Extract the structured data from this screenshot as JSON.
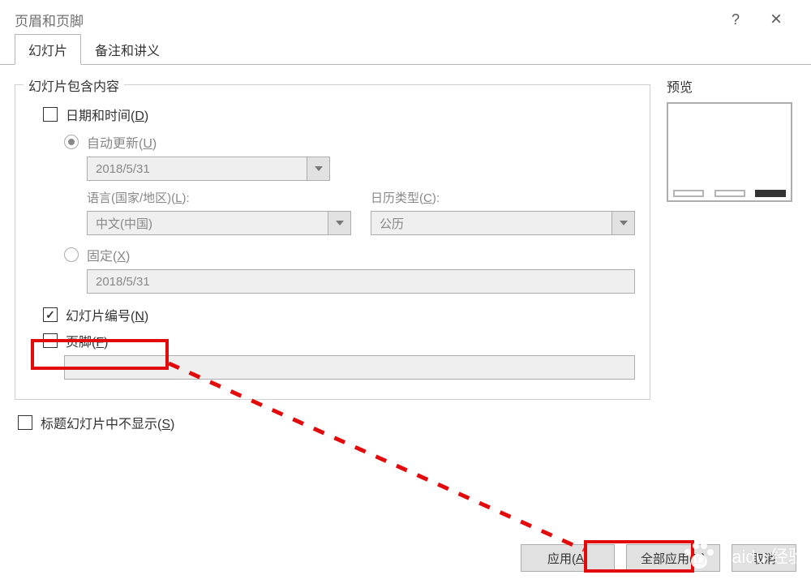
{
  "title": "页眉和页脚",
  "titlebar": {
    "help": "?",
    "close": "×"
  },
  "tabs": {
    "slide": "幻灯片",
    "notes": "备注和讲义"
  },
  "fieldset_legend": "幻灯片包含内容",
  "datetime": {
    "label_pre": "日期和时间(",
    "label_u": "D",
    "label_post": ")",
    "auto_pre": "自动更新(",
    "auto_u": "U",
    "auto_post": ")",
    "date_value": "2018/5/31",
    "lang_label_pre": "语言(国家/地区)(",
    "lang_label_u": "L",
    "lang_label_post": "):",
    "lang_value": "中文(中国)",
    "cal_label_pre": "日历类型(",
    "cal_label_u": "C",
    "cal_label_post": "):",
    "cal_value": "公历",
    "fixed_pre": "固定(",
    "fixed_u": "X",
    "fixed_post": ")",
    "fixed_value": "2018/5/31"
  },
  "slide_number": {
    "pre": "幻灯片编号(",
    "u": "N",
    "post": ")"
  },
  "footer_opt": {
    "pre": "页脚(",
    "u": "F",
    "post": ")",
    "value": ""
  },
  "dont_show": {
    "pre": "标题幻灯片中不显示(",
    "u": "S",
    "post": ")"
  },
  "preview_label": "预览",
  "buttons": {
    "apply_pre": "应用(",
    "apply_u": "A",
    "apply_post": ")",
    "applyall_pre": "全部应用(",
    "applyall_u": "Y",
    "applyall_post": ")",
    "cancel": "取消"
  },
  "watermark": "Baidu 经验"
}
